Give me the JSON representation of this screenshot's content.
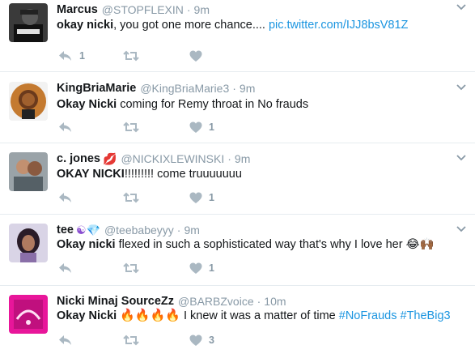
{
  "tweets": [
    {
      "name": "Marcus",
      "handle": "@STOPFLEXIN",
      "time": "9m",
      "bold": "okay nicki",
      "text": ", you got one more chance....",
      "link": "pic.twitter.com/IJJ8bsV81Z",
      "reply_count": "1",
      "like_count": ""
    },
    {
      "name": "KingBriaMarie",
      "handle": "@KingBriaMarie3",
      "time": "9m",
      "bold": "Okay Nicki",
      "text": " coming for Remy throat in No frauds",
      "reply_count": "",
      "like_count": "1"
    },
    {
      "name": "c. jones",
      "name_emoji": "💋",
      "handle": "@NICKIXLEWINSKI",
      "time": "9m",
      "bold": "OKAY NICKI",
      "text": "!!!!!!!!! come truuuuuuu",
      "reply_count": "",
      "like_count": "1"
    },
    {
      "name": "tee",
      "name_emoji": "☯💎",
      "handle": "@teebabeyyy",
      "time": "9m",
      "bold": "Okay nicki",
      "text": " flexed in such a sophisticated way that's why I love her",
      "text_emoji": "😂🙌🏾",
      "reply_count": "",
      "like_count": "1"
    },
    {
      "name": "Nicki Minaj SourceZz",
      "handle": "@BARBZvoice",
      "time": "10m",
      "bold": "Okay Nicki",
      "text_emoji_before": "🔥🔥🔥🔥",
      "text": " I knew it was a matter of time ",
      "hashtags": "#NoFrauds #TheBig3",
      "reply_count": "",
      "like_count": "3"
    }
  ],
  "separator": "·",
  "colors": {
    "name": "#14171a",
    "meta": "#8899a6",
    "link": "#1b95e0",
    "border": "#e6ecf0",
    "icon": "#aab8c2"
  },
  "icons": [
    "reply-icon",
    "retweet-icon",
    "like-icon",
    "caret-down-icon"
  ]
}
